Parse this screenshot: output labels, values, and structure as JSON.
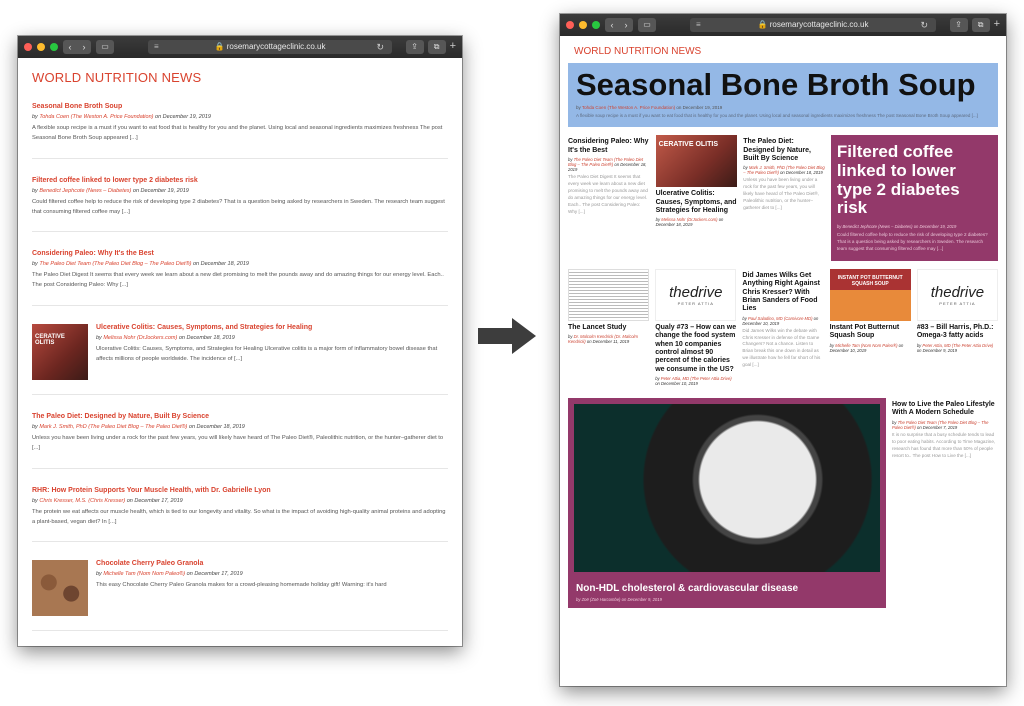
{
  "browser": {
    "url": "rosemarycottageclinic.co.uk"
  },
  "left": {
    "site_title": "WORLD NUTRITION NEWS",
    "posts": [
      {
        "title": "Seasonal Bone Broth Soup",
        "author": "Tohda Coen (The Weston A. Price Foundation)",
        "date": "on December 19, 2019",
        "excerpt": "A flexible soup recipe is a must if you want to eat food that is healthy for you and the planet. Using local and seasonal ingredients maximizes freshness The post Seasonal Bone Broth Soup appeared [...]"
      },
      {
        "title": "Filtered coffee linked to lower type 2 diabetes risk",
        "author": "Benedict Jephcote (News – Diabetes)",
        "date": "on December 19, 2019",
        "excerpt": "Could filtered coffee help to reduce the risk of developing type 2 diabetes? That is a question being asked by researchers in Sweden. The research team suggest that consuming filtered coffee may [...]"
      },
      {
        "title": "Considering Paleo: Why It's the Best",
        "author": "The Paleo Diet Team (The Paleo Diet Blog – The Paleo Diet®)",
        "date": "on December 18, 2019",
        "excerpt": "The Paleo Diet Digest It seems that every week we learn about a new diet promising to melt the pounds away and do amazing things for our energy level. Each.. The post Considering Paleo: Why [...]"
      },
      {
        "title": "Ulcerative Colitis: Causes, Symptoms, and Strategies for Healing",
        "author": "Melissa Nohr (DrJockers.com)",
        "date": "on December 18, 2019",
        "excerpt": "Ulcerative Colitis: Causes, Symptoms, and Strategies for Healing  Ulcerative colitis is a major form of inflammatory bowel disease that affects millions of people worldwide. The incidence of [...]",
        "thumb": "CERATIVE OLITIS"
      },
      {
        "title": "The Paleo Diet: Designed by Nature, Built By Science",
        "author": "Mark J. Smith, PhD (The Paleo Diet Blog – The Paleo Diet®)",
        "date": "on December 18, 2019",
        "excerpt": "Unless you have been living under a rock for the past few years, you will likely have heard of The Paleo Diet®, Paleolithic nutrition, or the hunter–gatherer diet to [...]"
      },
      {
        "title": "RHR: How Protein Supports Your Muscle Health, with Dr. Gabrielle Lyon",
        "author": "Chris Kresser, M.S. (Chris Kresser)",
        "date": "on December 17, 2019",
        "excerpt": "The protein we eat affects our muscle health, which is tied to our longevity and vitality. So what is the impact of avoiding high-quality animal proteins and adopting a plant-based, vegan diet? In [...]"
      },
      {
        "title": "Chocolate Cherry Paleo Granola",
        "author": "Michelle Tam (Nom Nom Paleo®)",
        "date": "on December 17, 2019",
        "excerpt": "This easy Chocolate Cherry Paleo Granola makes for a crowd-pleasing homemade holiday gift! Warning: it's hard"
      }
    ]
  },
  "right": {
    "site_title": "WORLD NUTRITION NEWS",
    "hero": {
      "title": "Seasonal Bone Broth Soup",
      "author": "Tohda Coen (The Weston A. Price Foundation)",
      "date": "on December 19, 2019",
      "excerpt": "A flexible soup recipe is a must if you want to eat food that is healthy for you and the planet. Using local and seasonal ingredients maximizes freshness The post Seasonal Bone Broth Soup appeared [...]"
    },
    "row1": [
      {
        "title": "Considering Paleo: Why It's the Best",
        "author": "The Paleo Diet Team (The Paleo Diet Blog – The Paleo Diet®)",
        "date": "on December 18, 2019",
        "excerpt": "The Paleo Diet Digest It seems that every week we learn about a new diet promising to melt the pounds away and do amazing things for our energy level. Each.. The post Considering Paleo: Why [...]"
      },
      {
        "title": "Ulcerative Colitis: Causes, Symptoms, and Strategies for Healing",
        "author": "Melissa Nohr (DrJockers.com)",
        "date": "on December 18, 2019",
        "thumb": "CERATIVE OLITIS"
      },
      {
        "title": "The Paleo Diet: Designed by Nature, Built By Science",
        "author": "Mark J. Smith, PhD (The Paleo Diet Blog – The Paleo Diet®)",
        "date": "on December 18, 2019",
        "excerpt": "Unless you have been living under a rock for the past few years, you will likely have heard of The Paleo Diet®, Paleolithic nutrition, or the hunter–gatherer diet to [...]"
      },
      {
        "title": "Filtered coffee linked to lower type 2 diabetes risk",
        "author": "Benedict Jephcote (News – Diabetes)",
        "date": "on December 19, 2019",
        "excerpt": "Could filtered coffee help to reduce the risk of developing type 2 diabetes? That is a question being asked by researchers in Sweden. The research team suggest that consuming filtered coffee may [...]"
      }
    ],
    "row2": [
      {
        "title": "The Lancet Study",
        "author": "Dr. Malcolm Kendrick (Dr. Malcolm Kendrick)",
        "date": "on December 11, 2019"
      },
      {
        "title": "Qualy #73 – How can we change the food system when 10 companies control almost 90 percent of the calories we consume in the US?",
        "author": "Peter Attia, MD (The Peter Attia Drive)",
        "date": "on December 10, 2019",
        "logo": "thedrive",
        "logo_sub": "PETER ATTIA"
      },
      {
        "title": "Did James Wilks Get Anything Right Against Chris Kresser? With Brian Sanders of Food Lies",
        "author": "Paul Saladino, MD (Carnivore MD)",
        "date": "on December 10, 2019",
        "excerpt": "Did James Wilks win the debate with Chris Kresser in defense of the Game Changers? Not a chance. Listen to Brian break this one down in detail as we illustrate how he fell far short of his goal [...]"
      },
      {
        "title": "Instant Pot Butternut Squash Soup",
        "author": "Michelle Tam (Nom Nom Paleo®)",
        "date": "on December 10, 2019",
        "thumb": "INSTANT POT BUTTERNUT SQUASH SOUP"
      },
      {
        "title": "#83 – Bill Harris, Ph.D.: Omega-3 fatty acids",
        "author": "Peter Attia, MD (The Peter Attia Drive)",
        "date": "on December 9, 2019",
        "logo": "thedrive",
        "logo_sub": "PETER ATTIA"
      }
    ],
    "big_feature": {
      "title": "Non-HDL cholesterol & cardiovascular disease",
      "author": "Zoë (Zoë Harcombe)",
      "date": "on December 9, 2019"
    },
    "side": {
      "title": "How to Live the Paleo Lifestyle With A Modern Schedule",
      "author": "The Paleo Diet Team (The Paleo Diet Blog – The Paleo Diet®)",
      "date": "on December 7, 2019",
      "excerpt": "It is no surprise that a busy schedule tends to lead to poor eating habits. According to Time Magazine, research has found that more than 50% of people resort to.. The post How to Live the [...]"
    }
  }
}
